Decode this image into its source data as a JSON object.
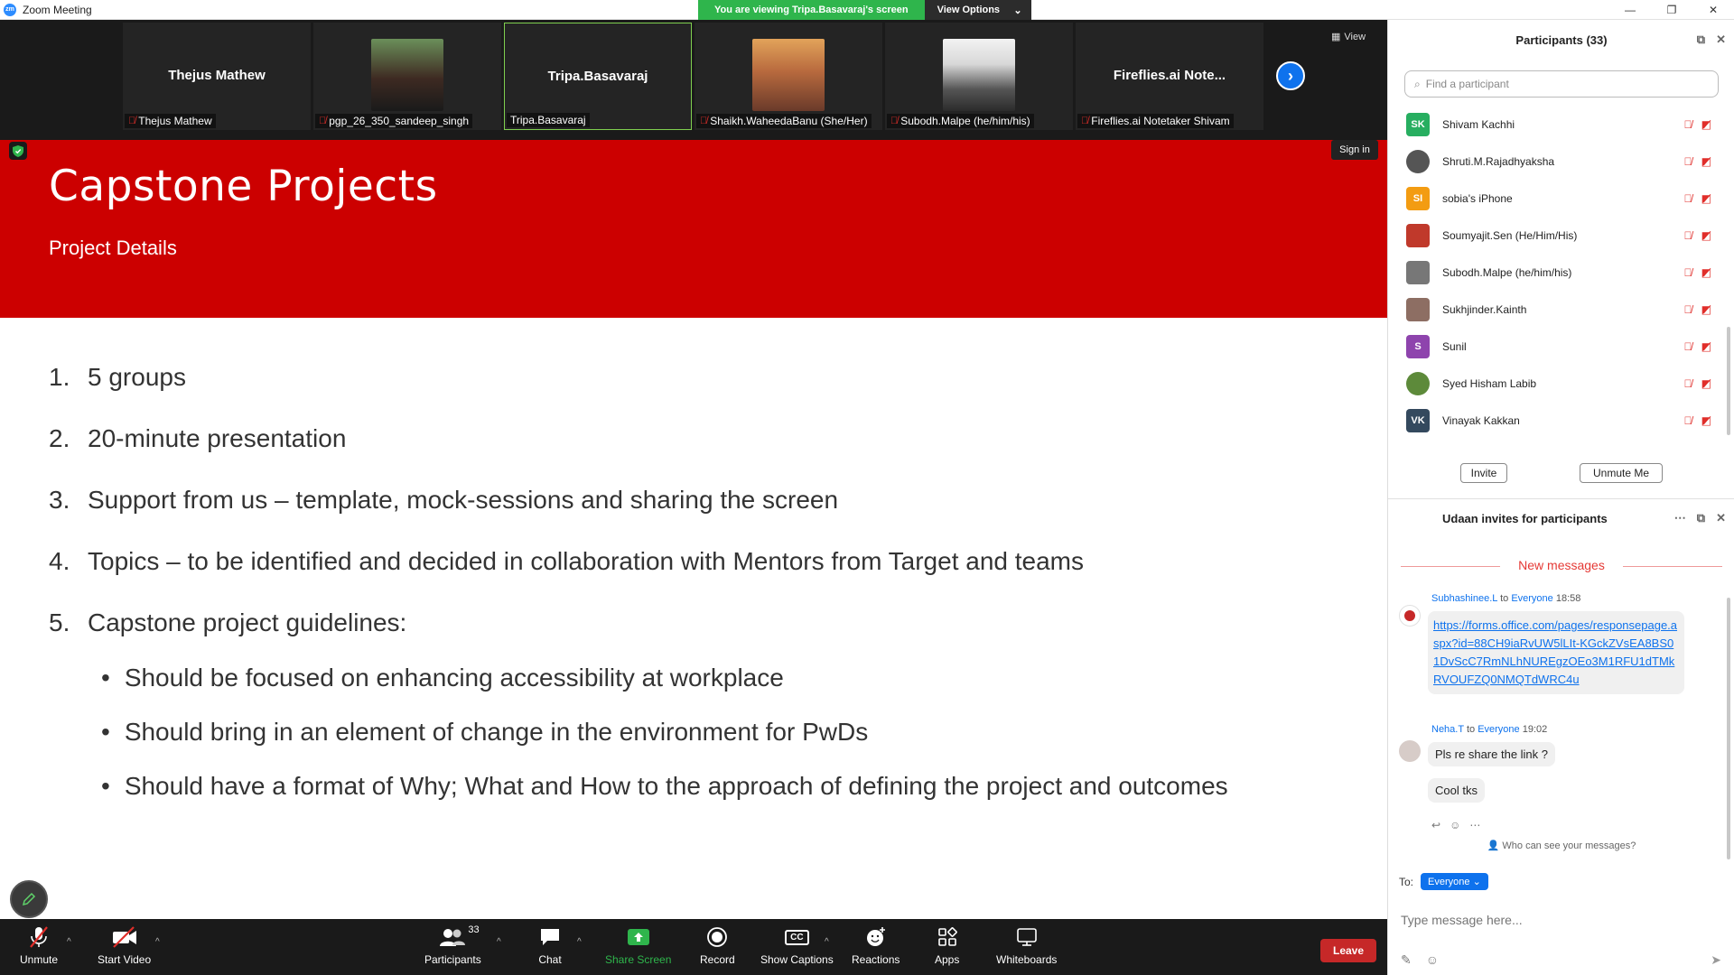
{
  "window": {
    "title": "Zoom Meeting",
    "logo_text": "zm",
    "controls": [
      "—",
      "❐",
      "✕"
    ]
  },
  "banner": {
    "message": "You are viewing Tripa.Basavaraj's screen",
    "view_options": "View Options"
  },
  "strip": {
    "view_label": "View",
    "tiles": [
      {
        "big": "Thejus Mathew",
        "label": "Thejus Mathew",
        "muted": true
      },
      {
        "big": "",
        "label": "pgp_26_350_sandeep_singh",
        "muted": true
      },
      {
        "big": "Tripa.Basavaraj",
        "label": "Tripa.Basavaraj",
        "muted": false
      },
      {
        "big": "",
        "label": "Shaikh.WaheedaBanu (She/Her)",
        "muted": true
      },
      {
        "big": "",
        "label": "Subodh.Malpe (he/him/his)",
        "muted": true
      },
      {
        "big": "Fireflies.ai  Note...",
        "label": "Fireflies.ai Notetaker Shivam",
        "muted": true
      }
    ]
  },
  "slide": {
    "sign_in": "Sign in",
    "title": "Capstone Projects",
    "subtitle": "Project Details",
    "items": [
      {
        "num": "1.",
        "text": "5 groups"
      },
      {
        "num": "2.",
        "text": "20-minute presentation"
      },
      {
        "num": "3.",
        "text": "Support from us – template, mock-sessions and sharing the screen"
      },
      {
        "num": "4.",
        "text": "Topics – to be identified and decided in collaboration with Mentors from Target and teams"
      },
      {
        "num": "5.",
        "text": "Capstone project guidelines:"
      }
    ],
    "bullets": [
      "Should be focused on enhancing accessibility at workplace",
      "Should bring in an element of change in the environment for PwDs",
      "Should have a format of Why; What and How to the approach of defining the project and outcomes"
    ]
  },
  "toolbar": {
    "unmute": "Unmute",
    "start_video": "Start Video",
    "participants": "Participants",
    "participants_count": "33",
    "chat": "Chat",
    "share_screen": "Share Screen",
    "record": "Record",
    "show_captions": "Show Captions",
    "reactions": "Reactions",
    "apps": "Apps",
    "whiteboards": "Whiteboards",
    "leave": "Leave",
    "cc_text": "CC"
  },
  "participants": {
    "title": "Participants (33)",
    "search_placeholder": "Find a participant",
    "list": [
      {
        "initials": "SK",
        "name": "Shivam Kachhi",
        "color": "#27ae60"
      },
      {
        "initials": "",
        "name": "Shruti.M.Rajadhyaksha",
        "color": "#555555"
      },
      {
        "initials": "SI",
        "name": "sobia's iPhone",
        "color": "#f39c12"
      },
      {
        "initials": "",
        "name": "Soumyajit.Sen (He/Him/His)",
        "color": "#c0392b"
      },
      {
        "initials": "",
        "name": "Subodh.Malpe (he/him/his)",
        "color": "#777777"
      },
      {
        "initials": "",
        "name": "Sukhjinder.Kainth",
        "color": "#8d6e63"
      },
      {
        "initials": "S",
        "name": "Sunil",
        "color": "#8e44ad"
      },
      {
        "initials": "",
        "name": "Syed Hisham Labib",
        "color": "#5d8a3a"
      },
      {
        "initials": "VK",
        "name": "Vinayak Kakkan",
        "color": "#34495e"
      }
    ],
    "invite": "Invite",
    "unmute_me": "Unmute Me"
  },
  "chat": {
    "title": "Udaan invites for participants",
    "new_messages": "New messages",
    "messages": [
      {
        "sender": "Subhashinee.L",
        "to": "to",
        "recipient": "Everyone",
        "time": "18:58",
        "link": "https://forms.office.com/pages/responsepage.aspx?id=88CH9iaRvUW5lLIt-KGckZVsEA8BS01DvScC7RmNLhNUREgzOEo3M1RFU1dTMkRVOUFZQ0NMQTdWRC4u"
      },
      {
        "sender": "Neha.T",
        "to": "to",
        "recipient": "Everyone",
        "time": "19:02",
        "text1": "Pls re share the link ?",
        "text2": "Cool tks"
      }
    ],
    "who_can_see": "Who can see your messages?",
    "to_label": "To:",
    "to_value": "Everyone",
    "input_placeholder": "Type message here..."
  }
}
